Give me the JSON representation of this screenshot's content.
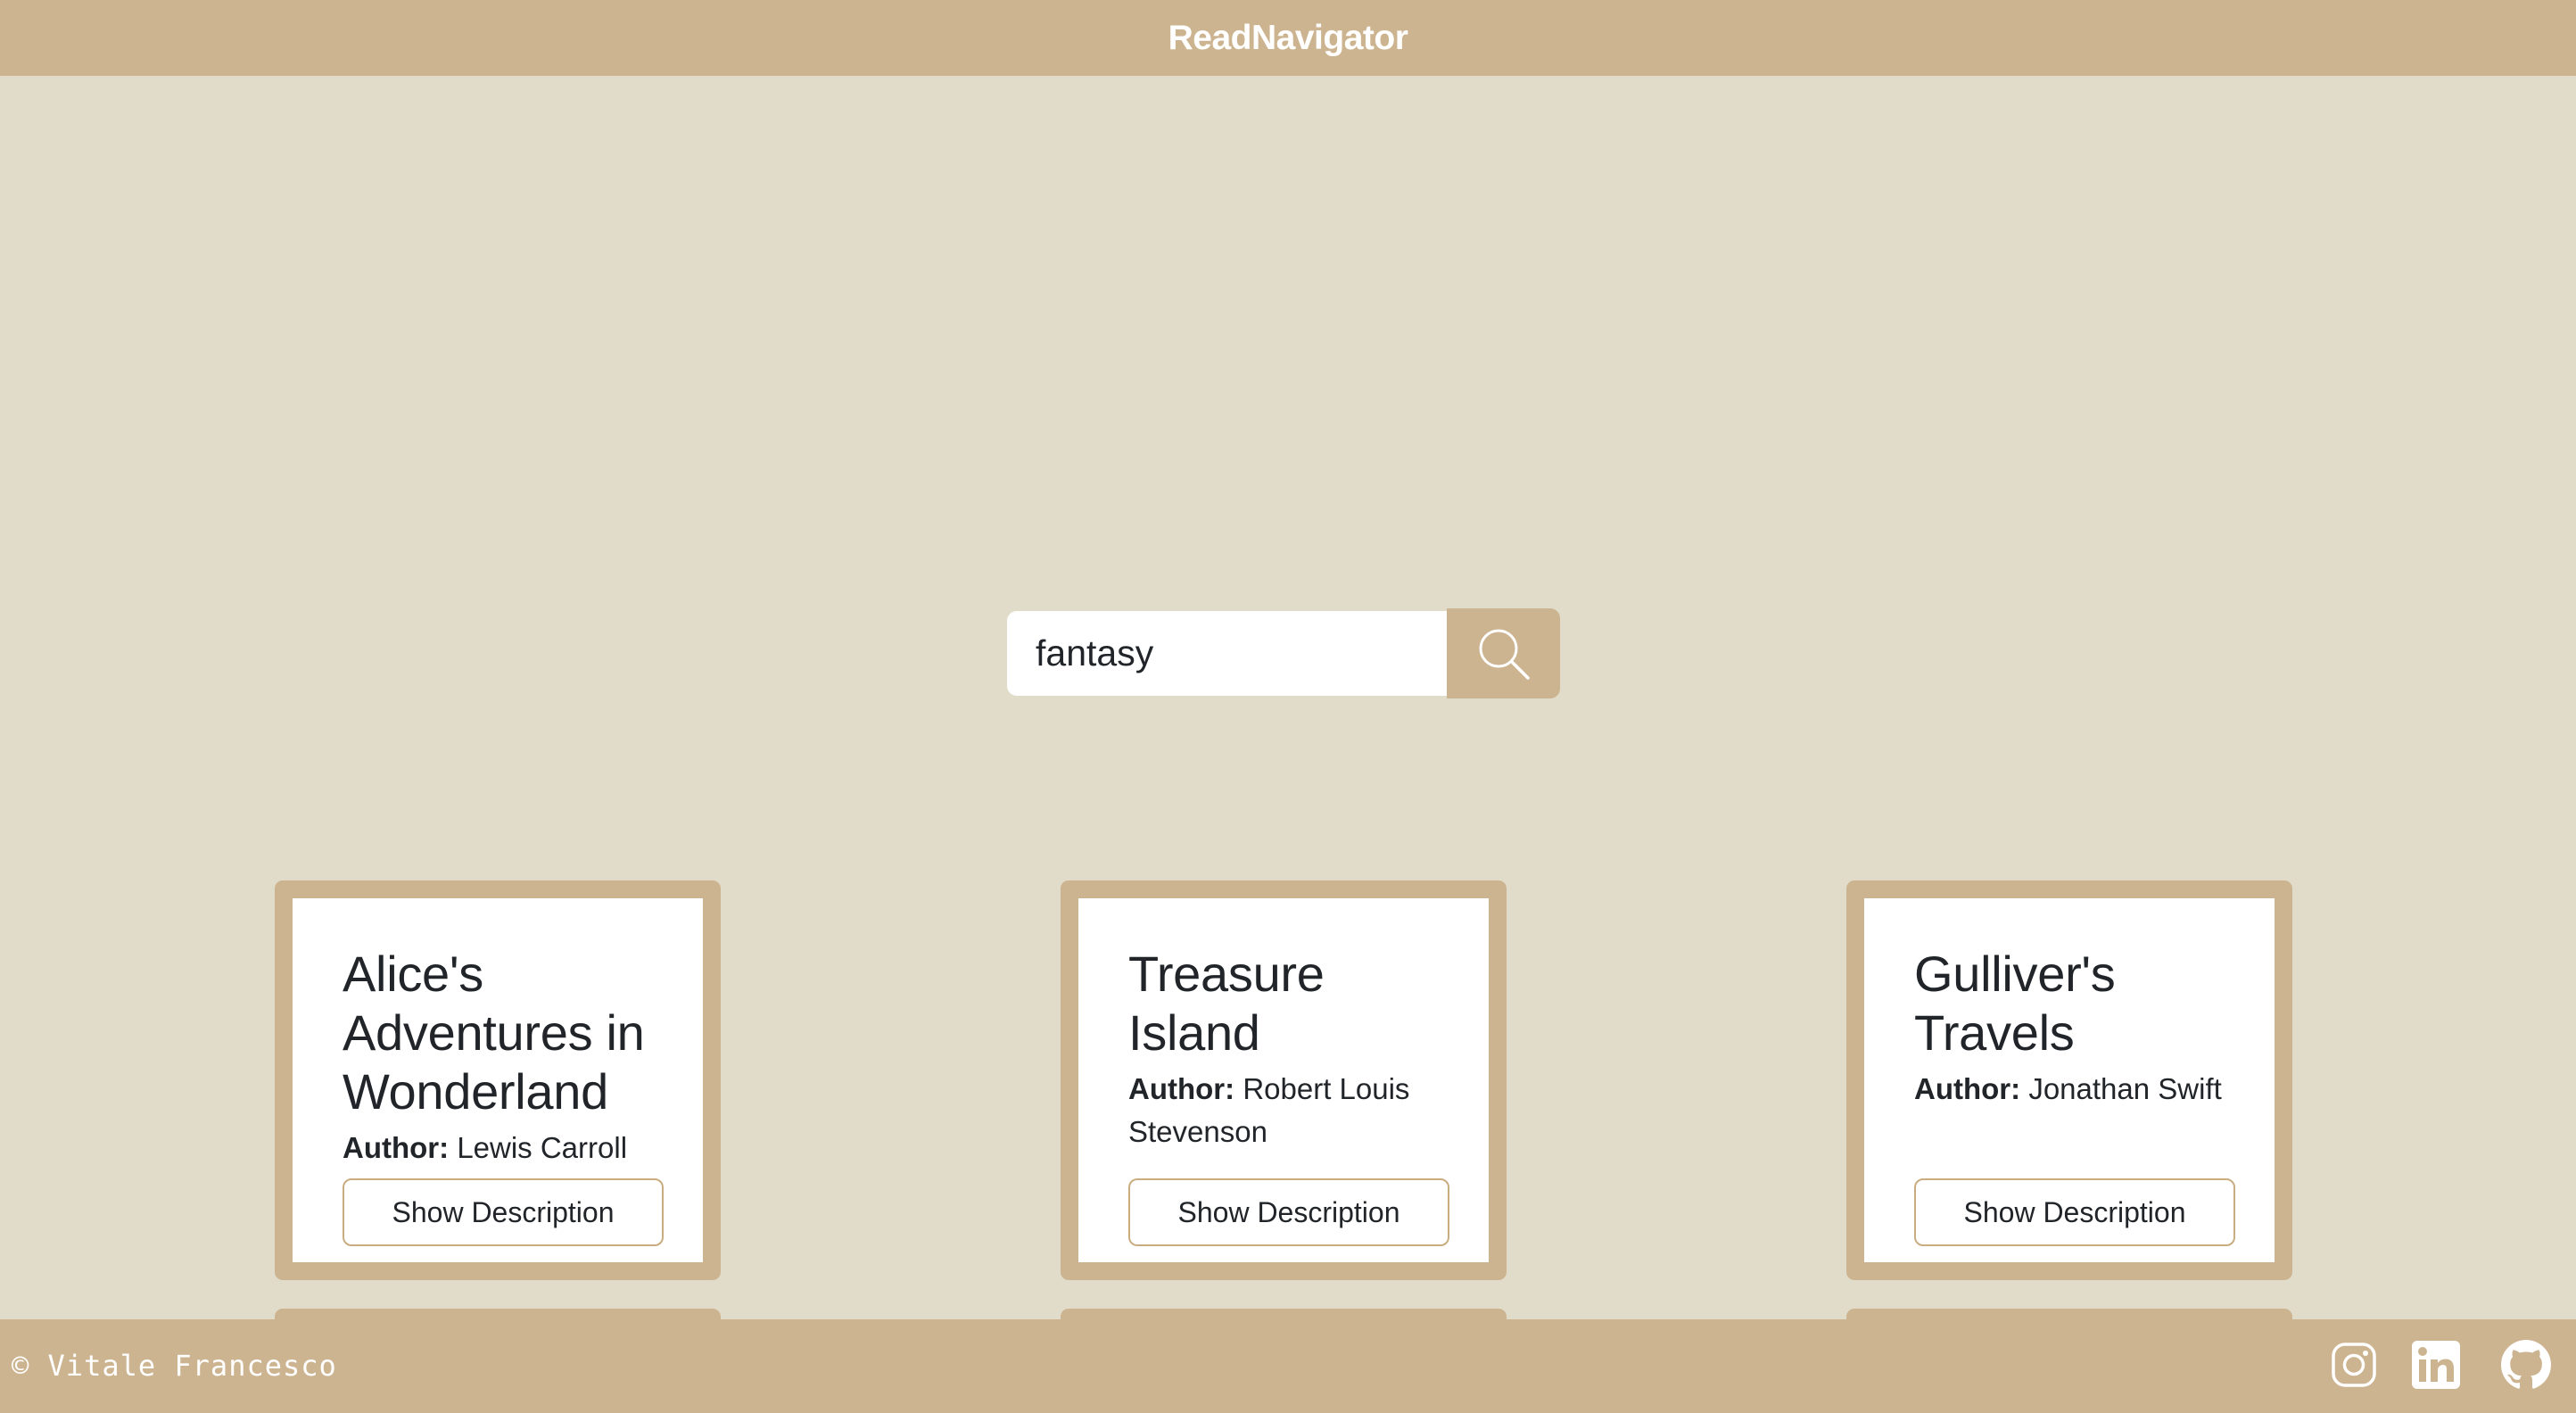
{
  "header": {
    "brand": "ReadNavigator"
  },
  "search": {
    "value": "fantasy",
    "button_icon": "search-icon"
  },
  "books": [
    {
      "title": "Alice's Adventures in Wonderland",
      "author_label": "Author:",
      "author": "Lewis Carroll",
      "button_label": "Show Description"
    },
    {
      "title": "Treasure Island",
      "author_label": "Author:",
      "author": "Robert Louis Stevenson",
      "button_label": "Show Description"
    },
    {
      "title": "Gulliver's Travels",
      "author_label": "Author:",
      "author": "Jonathan Swift",
      "button_label": "Show Description"
    }
  ],
  "footer": {
    "copyright": "© Vitale Francesco",
    "social_icons": [
      "instagram-icon",
      "linkedin-icon",
      "github-icon"
    ]
  },
  "colors": {
    "background": "#e1dcc9",
    "accent": "#cdb490",
    "card_inner": "#ffffff",
    "text": "#212529"
  }
}
